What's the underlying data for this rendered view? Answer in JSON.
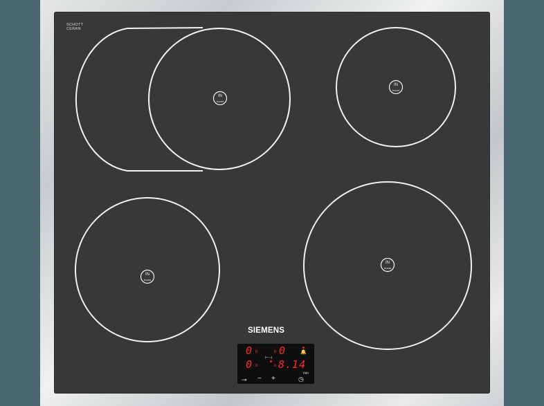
{
  "hob": {
    "certification": {
      "line1": "SCHOTT",
      "line2": "CERAN",
      "line3": ""
    },
    "brand": "SIEMENS",
    "zone_badge": {
      "top": "IN",
      "bottom": "boost"
    },
    "control_panel": {
      "zone1_value": "0",
      "zone2_value": "0",
      "zone3_value": "0",
      "timer_value": "8.14",
      "residual_marker": "b",
      "link_symbol": "⊢⊣",
      "min_label": "min",
      "minus_label": "−",
      "plus_label": "+",
      "key_icon": "child-lock-icon",
      "bell_icon": "bell-icon",
      "clock_icon": "clock-icon"
    }
  },
  "colors": {
    "glass": "#383838",
    "ring": "#f2f2f2",
    "display": "#ff2a2a",
    "frame": "#d6d9db",
    "background": "#4a6671"
  }
}
